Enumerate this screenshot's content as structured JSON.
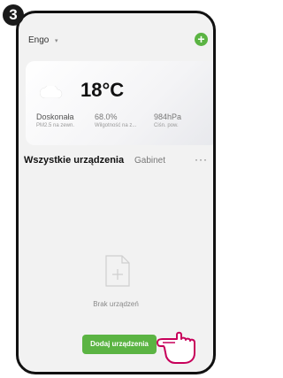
{
  "step_number": "3",
  "header": {
    "home_name": "Engo",
    "caret": "▾",
    "add_icon": "plus-icon"
  },
  "weather": {
    "icon": "cloud-icon",
    "temperature": "18°C",
    "stats": [
      {
        "value": "Doskonała",
        "label": "PM2.5 na zewn."
      },
      {
        "value": "68.0%",
        "label": "Wilgotność na z..."
      },
      {
        "value": "984hPa",
        "label": "Ciśn. pow."
      }
    ]
  },
  "tabs": {
    "all_devices": "Wszystkie urządzenia",
    "room": "Gabinet",
    "more": "···"
  },
  "empty_state": {
    "icon": "document-plus-icon",
    "text": "Brak urządzeń"
  },
  "add_device_button": {
    "label": "Dodaj urządzenia"
  },
  "colors": {
    "accent": "#5bb443",
    "frame": "#111111",
    "background": "#f2f2f2"
  },
  "overlay": {
    "hand_icon": "pointing-hand-icon"
  }
}
